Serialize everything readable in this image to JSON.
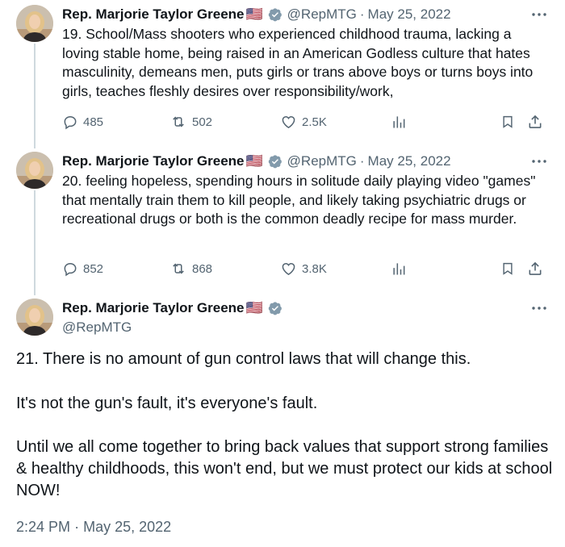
{
  "author": {
    "name": "Rep. Marjorie Taylor Greene",
    "flag": "🇺🇸",
    "handle": "@RepMTG",
    "verified_icon": "verified-badge-gray"
  },
  "colors": {
    "text": "#0f1419",
    "secondary": "#536471",
    "thread_line": "#cfd9de",
    "verified": "#829aab"
  },
  "tweets": [
    {
      "separator": "·",
      "date": "May 25, 2022",
      "text": "19. School/Mass shooters who experienced childhood trauma, lacking a loving stable home, being raised in an American Godless culture that hates masculinity, demeans men, puts girls or trans above boys or turns boys into girls, teaches fleshly desires over responsibility/work,",
      "replies": "485",
      "retweets": "502",
      "likes": "2.5K"
    },
    {
      "separator": "·",
      "date": "May 25, 2022",
      "text": "20. feeling hopeless, spending hours in solitude daily playing video \"games\" that mentally train them to kill people, and likely taking psychiatric drugs or recreational drugs or both is the common deadly recipe for mass murder.",
      "replies": "852",
      "retweets": "868",
      "likes": "3.8K"
    }
  ],
  "main_tweet": {
    "paragraphs": [
      "21. There is no amount of gun control laws that will change this.",
      "It's not the gun's fault, it's everyone's fault.",
      "Until we all come together to bring back values that support strong families & healthy childhoods, this won't end, but we must protect our kids at school NOW!"
    ],
    "time": "2:24 PM",
    "separator": "·",
    "date": "May 25, 2022"
  }
}
